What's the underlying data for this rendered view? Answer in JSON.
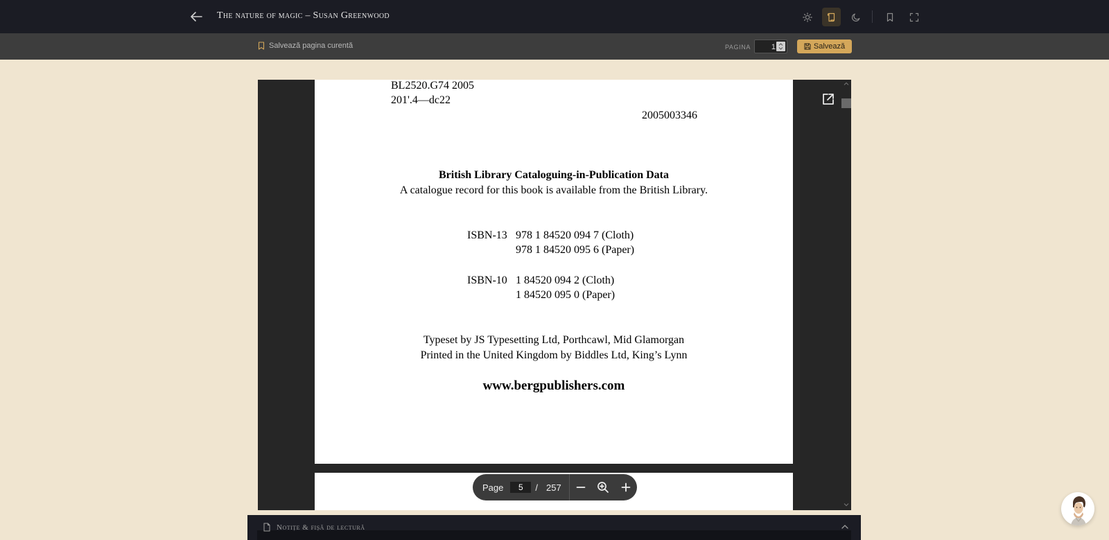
{
  "header": {
    "title": "The nature of magic – Susan Greenwood"
  },
  "subbar": {
    "save_current_label": "Salvează pagina curentă",
    "page_label": "PAGINA",
    "page_value": "1",
    "save_button_label": "Salvează"
  },
  "pdf": {
    "lines": {
      "lc_class": "BL2520.G74 2005",
      "dewey": "201'.4—dc22",
      "lccn": "2005003346",
      "bl_heading": "British Library Cataloguing-in-Publication Data",
      "bl_text": "A catalogue record for this book is available from the British Library.",
      "isbn13_label": "ISBN-13",
      "isbn13_cloth": "978 1 84520 094 7 (Cloth)",
      "isbn13_paper": "978 1 84520 095 6 (Paper)",
      "isbn10_label": "ISBN-10",
      "isbn10_cloth": "1 84520 094 2 (Cloth)",
      "isbn10_paper": "1 84520 095 0 (Paper)",
      "typeset": "Typeset by JS Typesetting Ltd, Porthcawl, Mid Glamorgan",
      "printed": "Printed in the United Kingdom by Biddles Ltd, King’s Lynn",
      "website": "www.bergpublishers.com"
    }
  },
  "pager": {
    "label": "Page",
    "current": "5",
    "separator": "/",
    "total": "257"
  },
  "notes": {
    "title": "Notițe & fișă de lectură"
  },
  "colors": {
    "topbar": "#1b1c24",
    "subbar": "#3d3d3d",
    "background": "#f0e5d0",
    "accent": "#d4a75a",
    "viewer": "#262626"
  },
  "icons": {
    "back": "arrow-left-icon",
    "light_mode": "sun-icon",
    "sepia_mode": "scroll-icon",
    "dark_mode": "moon-icon",
    "bookmark": "bookmark-icon",
    "fullscreen": "fullscreen-icon",
    "open_external": "open-external-icon",
    "zoom_out": "minus-icon",
    "zoom": "zoom-icon",
    "zoom_in": "plus-icon",
    "notes": "document-icon",
    "collapse": "chevron-up-icon"
  }
}
